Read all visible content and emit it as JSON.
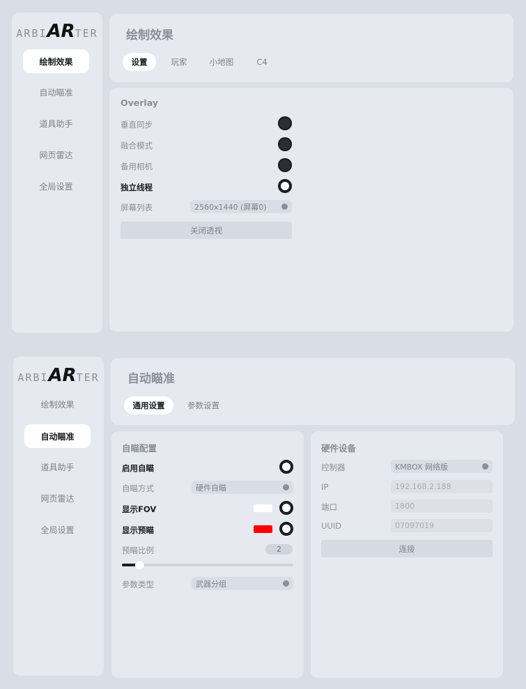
{
  "brand": {
    "pre": "ARBI",
    "mid": "AR",
    "post": "TER"
  },
  "nav": [
    "绘制效果",
    "自动瞄准",
    "道具助手",
    "网页雷达",
    "全局设置"
  ],
  "window1": {
    "title": "绘制效果",
    "tabs": [
      "设置",
      "玩家",
      "小地图",
      "C4"
    ],
    "active_tab": "设置",
    "section": "Overlay",
    "rows": [
      {
        "label": "垂直同步",
        "state": "off"
      },
      {
        "label": "融合模式",
        "state": "off"
      },
      {
        "label": "备用相机",
        "state": "off"
      },
      {
        "label": "独立线程",
        "state": "on"
      }
    ],
    "screen_list_label": "屏幕列表",
    "screen_list_value": "2560x1440 (屏幕0)",
    "close_button": "关闭透视"
  },
  "window2": {
    "title": "自动瞄准",
    "tabs": [
      "通用设置",
      "参数设置"
    ],
    "active_tab": "通用设置",
    "left": {
      "section": "自瞄配置",
      "enable_label": "启用自瞄",
      "enable_state": "on",
      "method_label": "自瞄方式",
      "method_value": "硬件自瞄",
      "fov_label": "显示FOV",
      "fov_color": "#ffffff",
      "fov_state": "on",
      "predict_label": "显示预瞄",
      "predict_color": "#ff0000",
      "predict_state": "on",
      "ratio_label": "预瞄比例",
      "ratio_value": "2",
      "ratio_slider": 0.08,
      "param_type_label": "参数类型",
      "param_type_value": "武器分组"
    },
    "right": {
      "section": "硬件设备",
      "controller_label": "控制器",
      "controller_value": "KMBOX 网络版",
      "ip_label": "IP",
      "ip_placeholder": "192.168.2.188",
      "port_label": "端口",
      "port_placeholder": "1800",
      "uuid_label": "UUID",
      "uuid_placeholder": "07097019",
      "connect_button": "连接"
    }
  }
}
